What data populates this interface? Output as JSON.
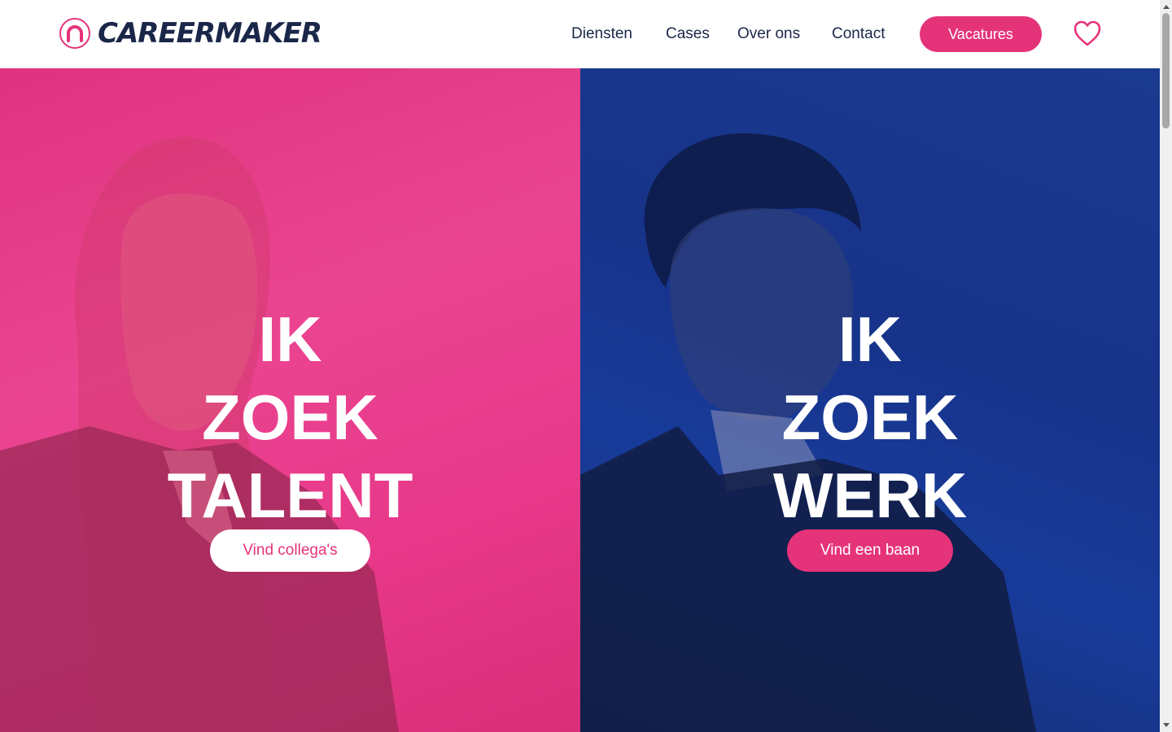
{
  "brand": {
    "name": "CAREERMAKER",
    "accent": "#e5337a",
    "dark": "#1a2748"
  },
  "nav": {
    "items": [
      {
        "label": "Diensten"
      },
      {
        "label": "Cases"
      },
      {
        "label": "Over ons"
      },
      {
        "label": "Contact"
      }
    ],
    "cta_label": "Vacatures",
    "favorites_icon": "heart-icon"
  },
  "hero": {
    "left": {
      "lines": [
        "IK",
        "ZOEK",
        "TALENT"
      ],
      "button_label": "Vind collega's",
      "bg_color": "#e8388a"
    },
    "right": {
      "lines": [
        "IK",
        "ZOEK",
        "WERK"
      ],
      "button_label": "Vind een baan",
      "bg_color": "#17338a"
    }
  }
}
